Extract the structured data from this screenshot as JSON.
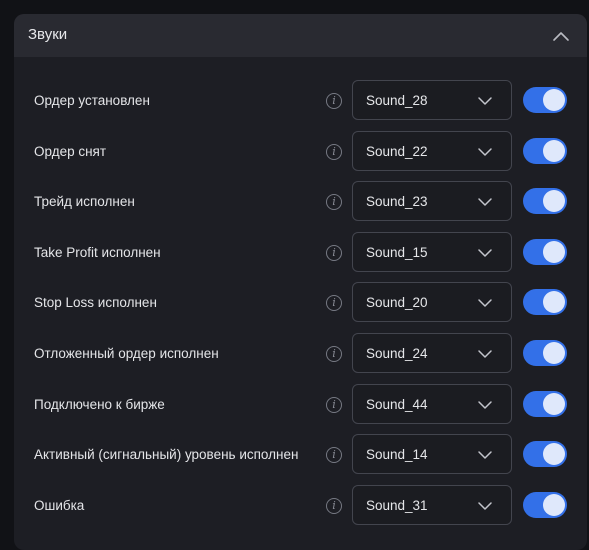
{
  "section": {
    "title": "Звуки",
    "collapse_icon": "chevron-up-icon"
  },
  "colors": {
    "toggle_on": "#3370e8",
    "panel_bg": "#1d1e24",
    "header_bg": "#292a31"
  },
  "info_glyph": "i",
  "rows": [
    {
      "label": "Ордер установлен",
      "sound": "Sound_28",
      "enabled": true
    },
    {
      "label": "Ордер снят",
      "sound": "Sound_22",
      "enabled": true
    },
    {
      "label": "Трейд исполнен",
      "sound": "Sound_23",
      "enabled": true
    },
    {
      "label": "Take Profit исполнен",
      "sound": "Sound_15",
      "enabled": true
    },
    {
      "label": "Stop Loss исполнен",
      "sound": "Sound_20",
      "enabled": true
    },
    {
      "label": "Отложенный ордер исполнен",
      "sound": "Sound_24",
      "enabled": true
    },
    {
      "label": "Подключено к бирже",
      "sound": "Sound_44",
      "enabled": true
    },
    {
      "label": "Активный (сигнальный) уровень исполнен",
      "sound": "Sound_14",
      "enabled": true
    },
    {
      "label": "Ошибка",
      "sound": "Sound_31",
      "enabled": true
    }
  ]
}
